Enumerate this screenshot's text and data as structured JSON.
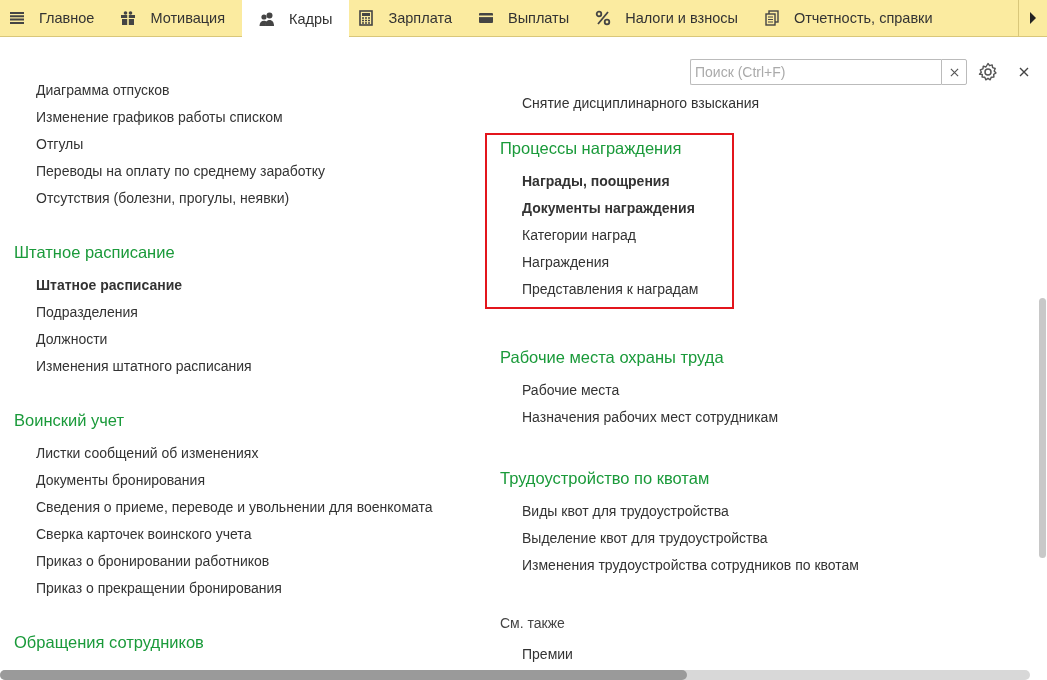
{
  "tabs": [
    {
      "label": "Главное",
      "selected": false
    },
    {
      "label": "Мотивация",
      "selected": false
    },
    {
      "label": "Кадры",
      "selected": true
    },
    {
      "label": "Зарплата",
      "selected": false
    },
    {
      "label": "Выплаты",
      "selected": false
    },
    {
      "label": "Налоги и взносы",
      "selected": false
    },
    {
      "label": "Отчетность, справки",
      "selected": false
    }
  ],
  "search": {
    "placeholder": "Поиск (Ctrl+F)"
  },
  "columns": [
    {
      "sections": [
        {
          "items": [
            {
              "label": "Диаграмма отпусков",
              "bold": false
            },
            {
              "label": "Изменение графиков работы списком",
              "bold": false
            },
            {
              "label": "Отгулы",
              "bold": false
            },
            {
              "label": "Переводы на оплату по среднему заработку",
              "bold": false
            },
            {
              "label": "Отсутствия (болезни, прогулы, неявки)",
              "bold": false
            }
          ]
        },
        {
          "title": "Штатное расписание",
          "kind": "group",
          "highlighted": false,
          "items": [
            {
              "label": "Штатное расписание",
              "bold": true
            },
            {
              "label": "Подразделения",
              "bold": false
            },
            {
              "label": "Должности",
              "bold": false
            },
            {
              "label": "Изменения штатного расписания",
              "bold": false
            }
          ]
        },
        {
          "title": "Воинский учет",
          "kind": "group",
          "highlighted": false,
          "items": [
            {
              "label": "Листки сообщений об изменениях",
              "bold": false
            },
            {
              "label": "Документы бронирования",
              "bold": false
            },
            {
              "label": "Сведения о приеме, переводе и увольнении для военкомата",
              "bold": false
            },
            {
              "label": "Сверка карточек воинского учета",
              "bold": false
            },
            {
              "label": "Приказ о бронировании работников",
              "bold": false
            },
            {
              "label": "Приказ о прекращении бронирования",
              "bold": false
            }
          ]
        },
        {
          "title": "Обращения сотрудников",
          "kind": "group",
          "highlighted": false
        }
      ]
    },
    {
      "sections": [
        {
          "items": [
            {
              "label": "Снятие дисциплинарного взыскания",
              "bold": false
            }
          ]
        },
        {
          "title": "Процессы награждения",
          "kind": "group",
          "highlighted": true,
          "items": [
            {
              "label": "Награды, поощрения",
              "bold": true
            },
            {
              "label": "Документы награждения",
              "bold": true
            },
            {
              "label": "Категории наград",
              "bold": false
            },
            {
              "label": "Награждения",
              "bold": false
            },
            {
              "label": "Представления к наградам",
              "bold": false
            }
          ]
        },
        {
          "title": "Рабочие места охраны труда",
          "kind": "group",
          "highlighted": false,
          "items": [
            {
              "label": "Рабочие места",
              "bold": false
            },
            {
              "label": "Назначения рабочих мест сотрудникам",
              "bold": false
            }
          ]
        },
        {
          "title": "Трудоустройство по квотам",
          "kind": "group",
          "highlighted": false,
          "items": [
            {
              "label": "Виды квот для трудоустройства",
              "bold": false
            },
            {
              "label": "Выделение квот для трудоустройства",
              "bold": false
            },
            {
              "label": "Изменения трудоустройства сотрудников по квотам",
              "bold": false
            }
          ]
        },
        {
          "title": "См. также",
          "kind": "see_also",
          "highlighted": false,
          "items": [
            {
              "label": "Премии",
              "bold": false
            }
          ]
        }
      ]
    }
  ]
}
